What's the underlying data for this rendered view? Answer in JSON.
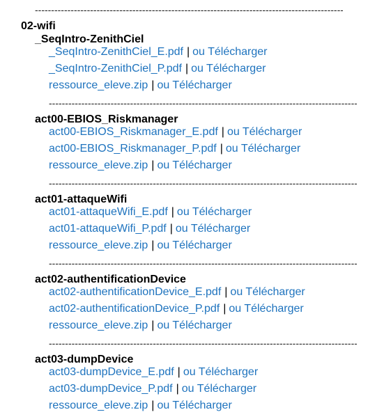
{
  "dash_text": "----------------------------------------------------------------------------------------------------------------------------",
  "folder": "02-wifi",
  "sep_char": "|",
  "sections": [
    {
      "title": "_SeqIntro-ZenithCiel",
      "files": [
        {
          "name": "_SeqIntro-ZenithCiel_E.pdf",
          "alt": "ou Télécharger"
        },
        {
          "name": "_SeqIntro-ZenithCiel_P.pdf",
          "alt": "ou Télécharger"
        },
        {
          "name": "ressource_eleve.zip",
          "alt": "ou Télécharger"
        }
      ]
    },
    {
      "title": "act00-EBIOS_Riskmanager",
      "files": [
        {
          "name": "act00-EBIOS_Riskmanager_E.pdf",
          "alt": "ou Télécharger"
        },
        {
          "name": "act00-EBIOS_Riskmanager_P.pdf",
          "alt": "ou Télécharger"
        },
        {
          "name": "ressource_eleve.zip",
          "alt": "ou Télécharger"
        }
      ]
    },
    {
      "title": "act01-attaqueWifi",
      "files": [
        {
          "name": "act01-attaqueWifi_E.pdf",
          "alt": "ou Télécharger"
        },
        {
          "name": "act01-attaqueWifi_P.pdf",
          "alt": "ou Télécharger"
        },
        {
          "name": "ressource_eleve.zip",
          "alt": "ou Télécharger"
        }
      ]
    },
    {
      "title": "act02-authentificationDevice",
      "files": [
        {
          "name": "act02-authentificationDevice_E.pdf",
          "alt": "ou Télécharger"
        },
        {
          "name": "act02-authentificationDevice_P.pdf",
          "alt": "ou Télécharger"
        },
        {
          "name": "ressource_eleve.zip",
          "alt": "ou Télécharger"
        }
      ]
    },
    {
      "title": "act03-dumpDevice",
      "files": [
        {
          "name": "act03-dumpDevice_E.pdf",
          "alt": "ou Télécharger"
        },
        {
          "name": "act03-dumpDevice_P.pdf",
          "alt": "ou Télécharger"
        },
        {
          "name": "ressource_eleve.zip",
          "alt": "ou Télécharger"
        }
      ]
    }
  ]
}
